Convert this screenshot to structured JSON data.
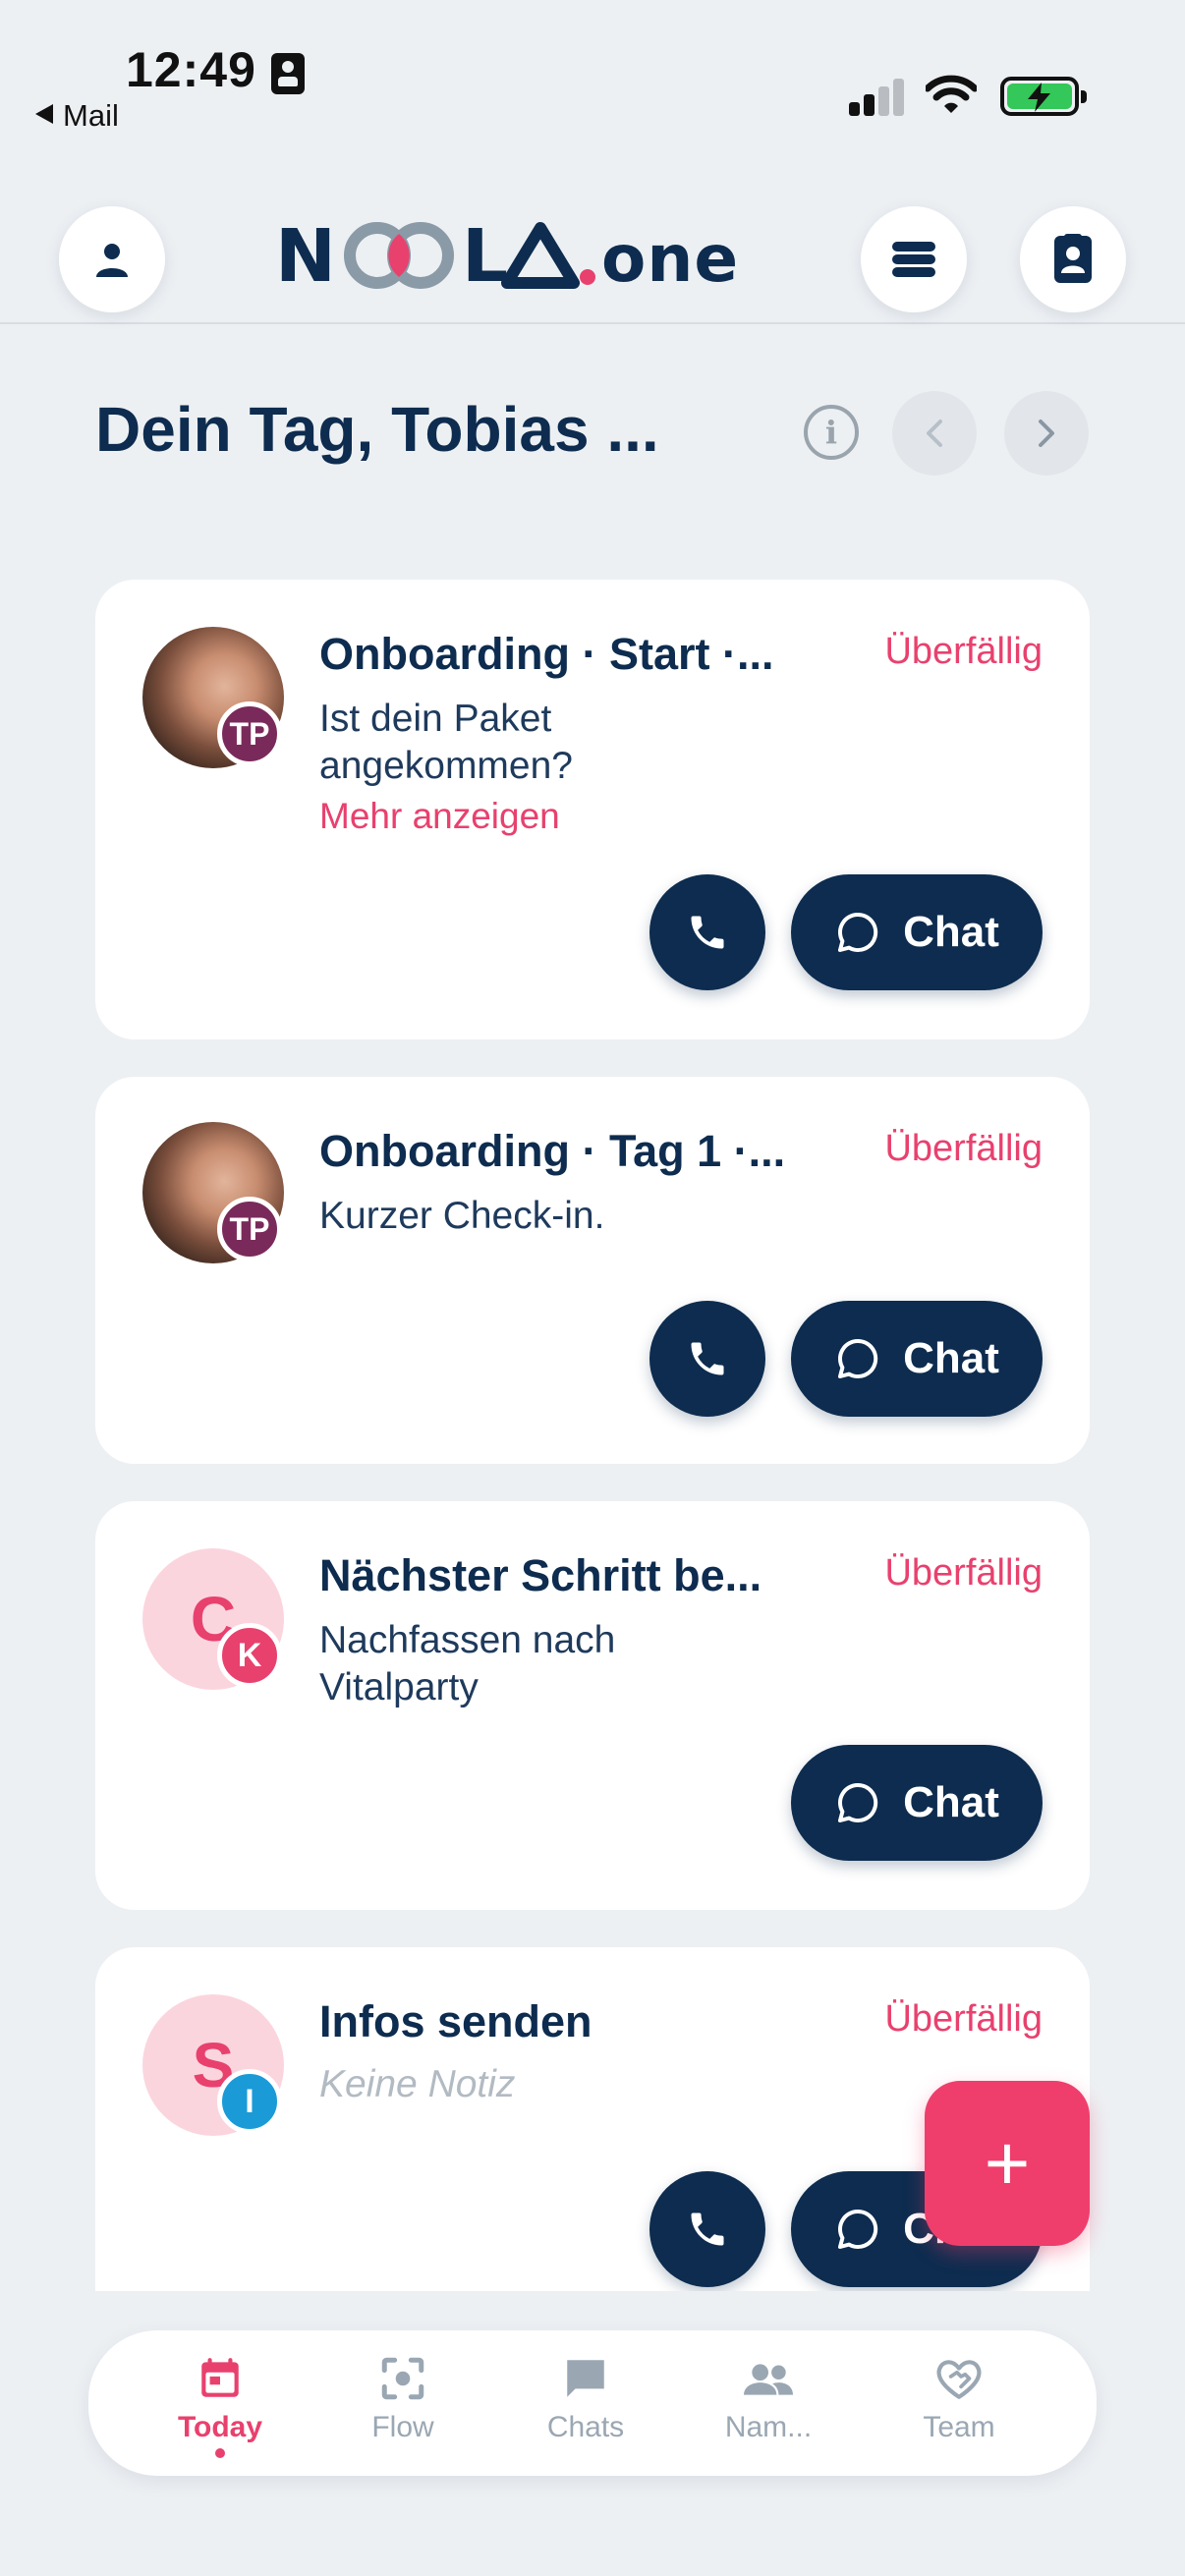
{
  "status_bar": {
    "time": "12:49",
    "back_label": "Mail"
  },
  "header": {
    "logo_text": "NOOLA.one",
    "profile_icon": "person-icon",
    "list_icon": "stack-icon",
    "contacts_icon": "contact-card-icon"
  },
  "page": {
    "title": "Dein Tag, Tobias ...",
    "info_symbol": "i"
  },
  "cards": [
    {
      "title": "Onboarding · Start ·...",
      "status": "Überfällig",
      "text": "Ist dein Paket angekommen?",
      "more": "Mehr anzeigen",
      "badge": "TP",
      "chat_label": "Chat"
    },
    {
      "title": "Onboarding · Tag 1 ·...",
      "status": "Überfällig",
      "text": "Kurzer Check-in.",
      "badge": "TP",
      "chat_label": "Chat"
    },
    {
      "title": "Nächster Schritt be...",
      "status": "Überfällig",
      "text": "Nachfassen nach Vitalparty",
      "avatar_letter": "C",
      "badge": "K",
      "chat_label": "Chat"
    },
    {
      "title": "Infos senden",
      "status": "Überfällig",
      "text": "Keine Notiz",
      "avatar_letter": "S",
      "badge": "I",
      "chat_label": "Chat"
    }
  ],
  "fab": {
    "symbol": "+"
  },
  "tabs": [
    {
      "label": "Today",
      "icon": "calendar-icon",
      "active": true
    },
    {
      "label": "Flow",
      "icon": "focus-icon",
      "active": false
    },
    {
      "label": "Chats",
      "icon": "chat-bubble-icon",
      "active": false
    },
    {
      "label": "Nam...",
      "icon": "people-icon",
      "active": false
    },
    {
      "label": "Team",
      "icon": "heart-handshake-icon",
      "active": false
    }
  ],
  "colors": {
    "primary": "#0d2c4f",
    "accent": "#e8416e",
    "background": "#edf0f3",
    "badge_tp": "#7a2a5a",
    "badge_k": "#e8416e",
    "badge_i": "#1b9ad8"
  }
}
